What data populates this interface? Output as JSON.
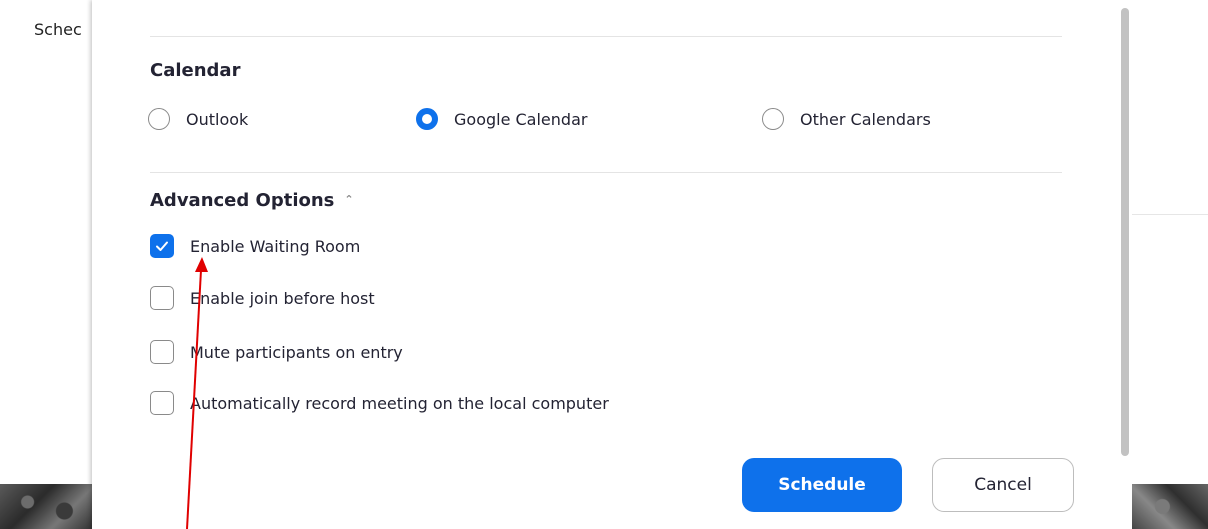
{
  "background": {
    "title_fragment": "Schec"
  },
  "calendar": {
    "title": "Calendar",
    "options": [
      {
        "label": "Outlook",
        "selected": false
      },
      {
        "label": "Google Calendar",
        "selected": true
      },
      {
        "label": "Other Calendars",
        "selected": false
      }
    ]
  },
  "advanced": {
    "title": "Advanced Options",
    "expanded": true,
    "options": [
      {
        "label": "Enable Waiting Room",
        "checked": true
      },
      {
        "label": "Enable join before host",
        "checked": false
      },
      {
        "label": "Mute participants on entry",
        "checked": false
      },
      {
        "label": "Automatically record meeting on the local computer",
        "checked": false
      }
    ]
  },
  "buttons": {
    "schedule": "Schedule",
    "cancel": "Cancel"
  },
  "icons": {
    "collapse": "chevron-up-icon",
    "check": "checkmark-icon",
    "annotation": "red-arrow"
  },
  "colors": {
    "accent": "#0e71eb",
    "annotation": "#e00000",
    "text": "#232333"
  }
}
